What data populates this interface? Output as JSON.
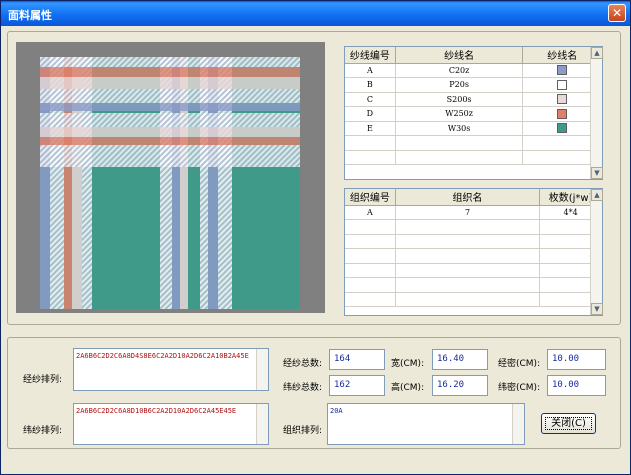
{
  "window": {
    "title": "面料属性"
  },
  "yarn_table": {
    "headers": [
      "纱线编号",
      "纱线名",
      "纱线名"
    ],
    "rows": [
      {
        "id": "A",
        "name": "C20z",
        "color": "#8c9bc8"
      },
      {
        "id": "B",
        "name": "P20s",
        "color": "#ffffff"
      },
      {
        "id": "C",
        "name": "S200s",
        "color": "#ead8d8"
      },
      {
        "id": "D",
        "name": "W250z",
        "color": "#e0806a"
      },
      {
        "id": "E",
        "name": "W30s",
        "color": "#3f9a8a"
      }
    ]
  },
  "weave_table": {
    "headers": [
      "组织编号",
      "组织名",
      "枚数(j*w)"
    ],
    "rows": [
      {
        "id": "A",
        "name": "7",
        "count": "4*4"
      }
    ]
  },
  "warp": {
    "label": "经纱排列:",
    "value": "2A6B6C2D2C6A8D4S8E6C2A2D10A2D6C2A10B2A45E"
  },
  "weft": {
    "label": "纬纱排列:",
    "value": "2A6B6C2D2C6A8D10B6C2A2D10A2D6C2A45E45E"
  },
  "stats": {
    "warp_total_label": "经纱总数:",
    "warp_total": "164",
    "weft_total_label": "纬纱总数:",
    "weft_total": "162",
    "width_label": "宽(CM):",
    "width": "16.40",
    "height_label": "高(CM):",
    "height": "16.20",
    "warp_density_label": "经密(CM):",
    "warp_density": "10.00",
    "weft_density_label": "纬密(CM):",
    "weft_density": "10.00"
  },
  "weave_seq": {
    "label": "组织排列:",
    "value": "20A"
  },
  "close_button": "关闭(C)",
  "colors": {
    "background": "#808080",
    "dialog": "#ece9d8",
    "accent": "#0a55d8"
  }
}
